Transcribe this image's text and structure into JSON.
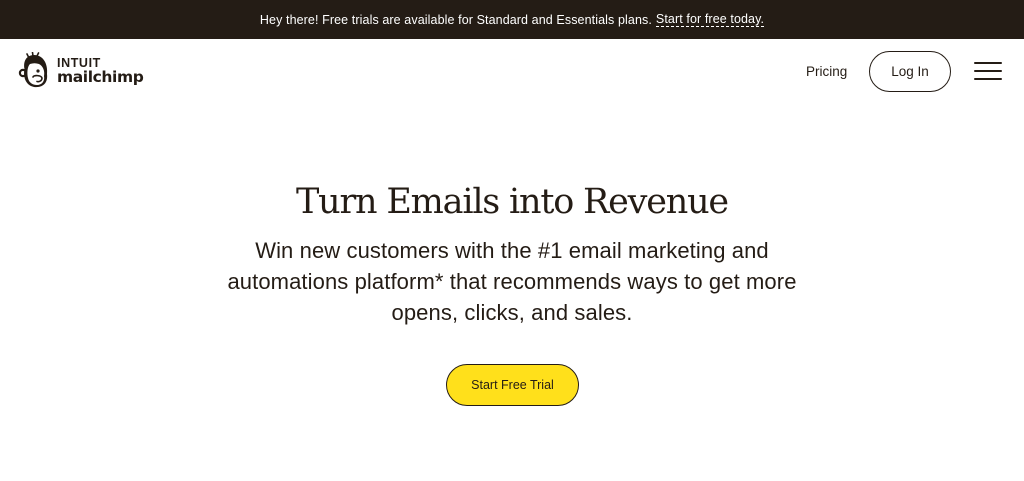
{
  "promo_bar": {
    "message": "Hey there! Free trials are available for Standard and Essentials plans.",
    "link_label": "Start for free today."
  },
  "header": {
    "logo": {
      "brand_top": "INTUIT",
      "brand_bottom": "mailchimp",
      "icon": "freddie-monkey-icon"
    },
    "nav": {
      "pricing_label": "Pricing",
      "login_label": "Log In",
      "menu_icon": "hamburger-menu-icon"
    }
  },
  "hero": {
    "title": "Turn Emails into Revenue",
    "subtitle": "Win new customers with the #1 email marketing and automations platform* that recommends ways to get more opens, clicks, and sales.",
    "cta_label": "Start Free Trial"
  },
  "colors": {
    "dark": "#241c15",
    "accent_yellow": "#ffe01b",
    "background": "#ffffff"
  }
}
